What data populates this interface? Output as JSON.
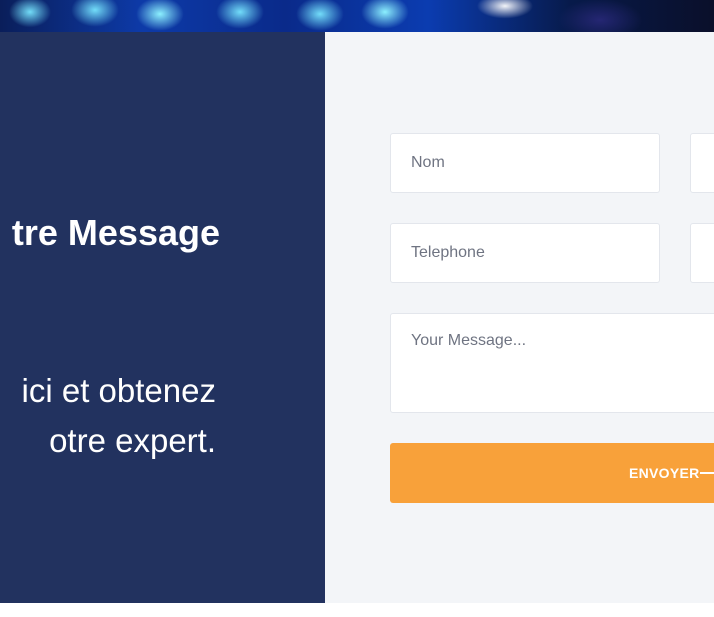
{
  "contact": {
    "title": "tre Message",
    "intro_lines": [
      "ici et obtenez",
      "otre expert."
    ],
    "form": {
      "name_placeholder": "Nom",
      "phone_placeholder": "Telephone",
      "message_placeholder": "Your Message...",
      "submit_label": "ENVOYER"
    }
  },
  "colors": {
    "left_panel": "#22325f",
    "form_background": "#f3f5f8",
    "button": "#f8a13a"
  },
  "icons": {
    "button_arrow": "arrow-line-icon"
  }
}
